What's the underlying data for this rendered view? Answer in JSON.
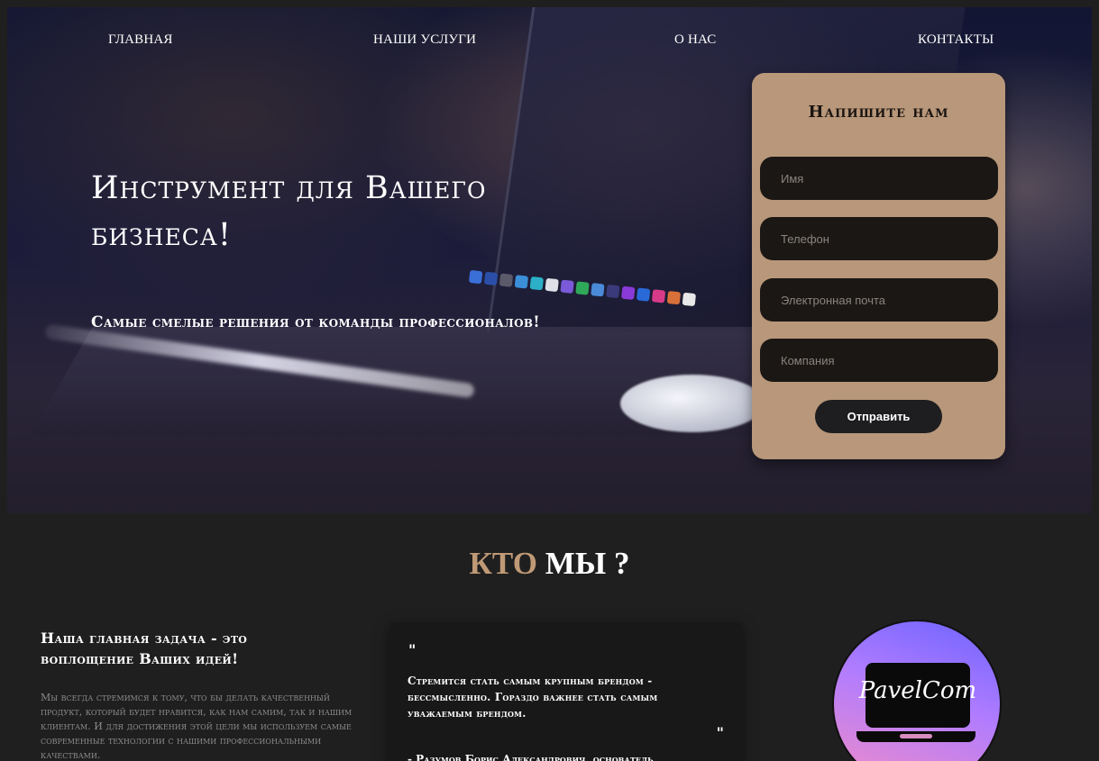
{
  "nav": {
    "items": [
      "ГЛАВНАЯ",
      "НАШИ УСЛУГИ",
      "О НАС",
      "КОНТАКТЫ"
    ]
  },
  "hero": {
    "title": "Инструмент для Вашего бизнеса!",
    "subtitle": "Самые смелые решения от команды профессионалов!"
  },
  "contact_form": {
    "title": "Напишите нам",
    "fields": [
      {
        "placeholder": "Имя"
      },
      {
        "placeholder": "Телефон"
      },
      {
        "placeholder": "Электронная почта"
      },
      {
        "placeholder": "Компания"
      }
    ],
    "submit_label": "Отправить"
  },
  "about": {
    "title_accent": "КТО",
    "title_rest": " МЫ ?",
    "mission_heading": "Наша главная задача - это воплощение Ваших идей!",
    "mission_text": "Мы всегда стремимся к тому, что бы делать качественный продукт, который будет нравится, как нам самим, так и нашим клиентам. И для достижения этой цели мы используем самые современные технологии с нашими профессиональными качествами.",
    "quote_open": "\"",
    "quote_text": "Стремится стать самым крупным брендом - бессмысленно. Гораздо важнее стать самым уважаемым брендом.",
    "quote_close": "\"",
    "quote_author": "- Разумов Борис Александрович, основатель"
  },
  "logo": {
    "text": "PavelCom"
  },
  "colors": {
    "accent": "#c09a76",
    "form_bg": "#b8977a",
    "page_bg": "#1f1f1f"
  }
}
